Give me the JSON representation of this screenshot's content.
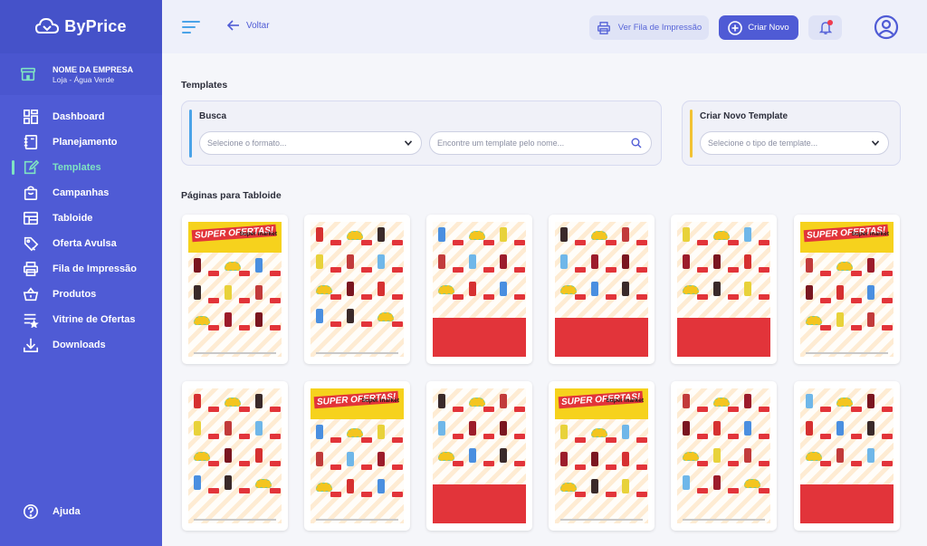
{
  "brand": {
    "name": "ByPrice"
  },
  "company": {
    "name": "NOME DA EMPRESA",
    "store": "Loja - Água Verde"
  },
  "sidebar": {
    "items": [
      {
        "label": "Dashboard",
        "icon": "dashboard-icon",
        "active": false
      },
      {
        "label": "Planejamento",
        "icon": "notebook-icon",
        "active": false
      },
      {
        "label": "Templates",
        "icon": "edit-template-icon",
        "active": true
      },
      {
        "label": "Campanhas",
        "icon": "bag-icon",
        "active": false
      },
      {
        "label": "Tabloide",
        "icon": "newspaper-icon",
        "active": false
      },
      {
        "label": "Oferta Avulsa",
        "icon": "price-tag-icon",
        "active": false
      },
      {
        "label": "Fila de Impressão",
        "icon": "printer-icon",
        "active": false
      },
      {
        "label": "Produtos",
        "icon": "basket-icon",
        "active": false
      },
      {
        "label": "Vitrine de Ofertas",
        "icon": "list-star-icon",
        "active": false
      },
      {
        "label": "Downloads",
        "icon": "download-icon",
        "active": false
      }
    ],
    "help": "Ajuda"
  },
  "header": {
    "back": "Voltar",
    "print_queue": "Ver Fila de Impressão",
    "create_new": "Criar Novo"
  },
  "templates": {
    "title": "Templates",
    "search": {
      "title": "Busca",
      "format_placeholder": "Selecione o formato...",
      "name_placeholder": "Encontre um template pelo nome..."
    },
    "create": {
      "title": "Criar Novo Template",
      "type_placeholder": "Selecione o tipo de template..."
    }
  },
  "tabloid_section": {
    "title": "Páginas para Tabloide",
    "banner_title": "SUPER OFERTAS!",
    "banner_brand": "Super market",
    "rows": [
      [
        "banner",
        "plain",
        "redblock",
        "plain-red",
        "plain-red",
        "banner"
      ],
      [
        "plain",
        "banner",
        "plain-red",
        "banner",
        "plain",
        "plain-red"
      ]
    ]
  },
  "colors": {
    "sidebar": "#4f5bd5",
    "accent": "#4f5bd5",
    "active": "#7fe3c2",
    "search_bar": "#4aa3e8",
    "create_bar": "#f2c232",
    "tabloid_red": "#e2343a",
    "tabloid_yellow": "#f6d21d"
  }
}
